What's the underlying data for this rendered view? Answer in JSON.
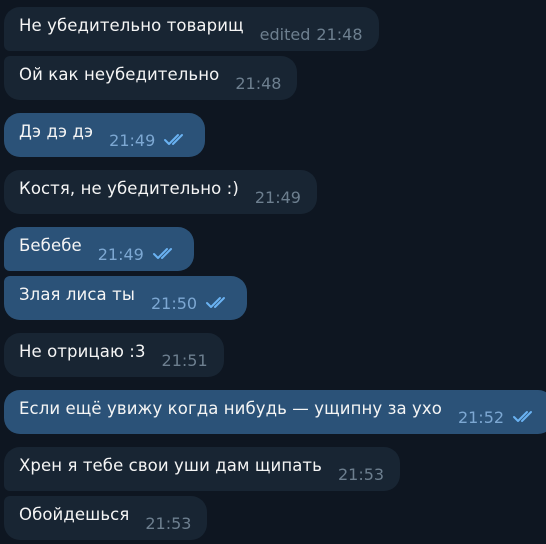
{
  "messages": [
    {
      "text": "Не убедительно товарищ",
      "time": "21:48",
      "edited": "edited",
      "outgoing": false
    },
    {
      "text": "Ой как неубедительно",
      "time": "21:48",
      "outgoing": false
    },
    {
      "text": "Дэ дэ дэ",
      "time": "21:49",
      "outgoing": true,
      "status": "read"
    },
    {
      "text": "Костя, не убедительно :)",
      "time": "21:49",
      "outgoing": false
    },
    {
      "text": "Бебебе",
      "time": "21:49",
      "outgoing": true,
      "status": "read"
    },
    {
      "text": "Злая лиса ты",
      "time": "21:50",
      "outgoing": true,
      "status": "read"
    },
    {
      "text": "Не отрицаю :3",
      "time": "21:51",
      "outgoing": false
    },
    {
      "text": "Если ещё увижу когда нибудь — ущипну за ухо",
      "time": "21:52",
      "outgoing": true,
      "status": "read"
    },
    {
      "text": "Хрен я тебе свои уши дам щипать",
      "time": "21:53",
      "outgoing": false
    },
    {
      "text": "Обойдешься",
      "time": "21:53",
      "outgoing": false
    }
  ],
  "colors": {
    "background": "#0e1621",
    "incoming_bubble": "#182533",
    "outgoing_bubble": "#2b5278",
    "read_check": "#6ab2f2"
  }
}
